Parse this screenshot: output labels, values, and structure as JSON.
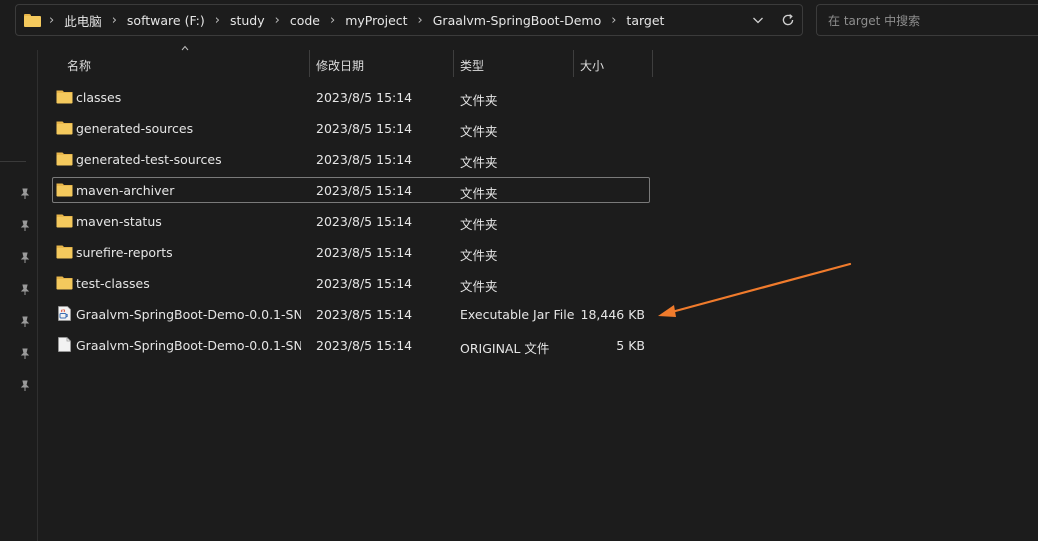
{
  "address": {
    "crumbs": [
      "此电脑",
      "software (F:)",
      "study",
      "code",
      "myProject",
      "Graalvm-SpringBoot-Demo",
      "target"
    ]
  },
  "search": {
    "placeholder": "在 target 中搜索"
  },
  "columns": {
    "name": "名称",
    "date": "修改日期",
    "type": "类型",
    "size": "大小"
  },
  "files": [
    {
      "name": "classes",
      "date": "2023/8/5 15:14",
      "type": "文件夹",
      "size": "",
      "icon": "folder-icon"
    },
    {
      "name": "generated-sources",
      "date": "2023/8/5 15:14",
      "type": "文件夹",
      "size": "",
      "icon": "folder-icon"
    },
    {
      "name": "generated-test-sources",
      "date": "2023/8/5 15:14",
      "type": "文件夹",
      "size": "",
      "icon": "folder-icon"
    },
    {
      "name": "maven-archiver",
      "date": "2023/8/5 15:14",
      "type": "文件夹",
      "size": "",
      "icon": "folder-icon",
      "focused": true
    },
    {
      "name": "maven-status",
      "date": "2023/8/5 15:14",
      "type": "文件夹",
      "size": "",
      "icon": "folder-icon"
    },
    {
      "name": "surefire-reports",
      "date": "2023/8/5 15:14",
      "type": "文件夹",
      "size": "",
      "icon": "folder-icon"
    },
    {
      "name": "test-classes",
      "date": "2023/8/5 15:14",
      "type": "文件夹",
      "size": "",
      "icon": "folder-icon"
    },
    {
      "name": "Graalvm-SpringBoot-Demo-0.0.1-SN...",
      "date": "2023/8/5 15:14",
      "type": "Executable Jar File",
      "size": "18,446 KB",
      "icon": "java-jar-icon"
    },
    {
      "name": "Graalvm-SpringBoot-Demo-0.0.1-SN...",
      "date": "2023/8/5 15:14",
      "type": "ORIGINAL 文件",
      "size": "5 KB",
      "icon": "blank-file-icon"
    }
  ],
  "colors": {
    "background": "#1c1c1c",
    "folder": "#f4c95d",
    "annotation_arrow": "#f07b2c"
  }
}
